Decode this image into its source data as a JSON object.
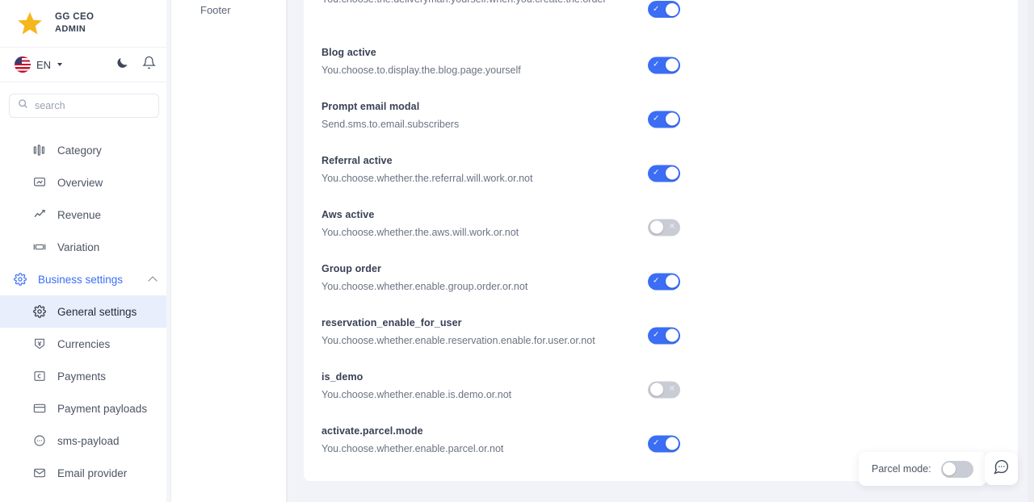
{
  "sidebar": {
    "brand": {
      "name": "GG CEO",
      "role": "ADMIN",
      "logo_icon": "star-icon"
    },
    "topbar": {
      "language": "EN",
      "flag_icon": "us-flag-icon",
      "dark_mode_icon": "moon-icon",
      "notifications_icon": "bell-icon"
    },
    "search": {
      "value": "",
      "placeholder": "search",
      "icon": "search-icon"
    },
    "items": [
      {
        "label": "Category",
        "icon": "category-icon",
        "state": "default"
      },
      {
        "label": "Overview",
        "icon": "overview-icon",
        "state": "default"
      },
      {
        "label": "Revenue",
        "icon": "trending-up-icon",
        "state": "default"
      },
      {
        "label": "Variation",
        "icon": "variation-icon",
        "state": "default"
      },
      {
        "label": "Business settings",
        "icon": "gear-icon",
        "state": "group-expanded"
      },
      {
        "label": "General settings",
        "icon": "gear-icon",
        "state": "active"
      },
      {
        "label": "Currencies",
        "icon": "currency-icon",
        "state": "default"
      },
      {
        "label": "Payments",
        "icon": "payments-icon",
        "state": "default"
      },
      {
        "label": "Payment payloads",
        "icon": "credit-card-icon",
        "state": "default"
      },
      {
        "label": "sms-payload",
        "icon": "chat-dots-icon",
        "state": "default"
      },
      {
        "label": "Email provider",
        "icon": "envelope-icon",
        "state": "default"
      }
    ]
  },
  "column2": {
    "items": [
      {
        "label": "Footer"
      }
    ]
  },
  "settings": {
    "rows": [
      {
        "title": "",
        "desc": "You.choose.the.deliveryman.yourself.when.you.create.the.order",
        "toggle": "on",
        "partial": true
      },
      {
        "title": "Blog active",
        "desc": "You.choose.to.display.the.blog.page.yourself",
        "toggle": "on"
      },
      {
        "title": "Prompt email modal",
        "desc": "Send.sms.to.email.subscribers",
        "toggle": "on"
      },
      {
        "title": "Referral active",
        "desc": "You.choose.whether.the.referral.will.work.or.not",
        "toggle": "on"
      },
      {
        "title": "Aws active",
        "desc": "You.choose.whether.the.aws.will.work.or.not",
        "toggle": "off"
      },
      {
        "title": "Group order",
        "desc": "You.choose.whether.enable.group.order.or.not",
        "toggle": "on"
      },
      {
        "title": "reservation_enable_for_user",
        "desc": "You.choose.whether.enable.reservation.enable.for.user.or.not",
        "toggle": "on"
      },
      {
        "title": "is_demo",
        "desc": "You.choose.whether.enable.is.demo.or.not",
        "toggle": "off"
      },
      {
        "title": "activate.parcel.mode",
        "desc": "You.choose.whether.enable.parcel.or.not",
        "toggle": "on"
      }
    ]
  },
  "floating": {
    "parcel_mode_label": "Parcel mode:",
    "parcel_mode_toggle": "off",
    "chat_icon": "chat-bubble-dots-icon"
  },
  "colors": {
    "accent": "#3b6ef5",
    "accent_soft": "#e8eefc",
    "toggle_on": "#3b6ef5",
    "toggle_off": "#c9ccd4",
    "page_bg": "#f2f3f8",
    "card_bg": "#ffffff",
    "title_text": "#384155",
    "desc_text": "#6b7383",
    "star": "#f5b71d"
  }
}
